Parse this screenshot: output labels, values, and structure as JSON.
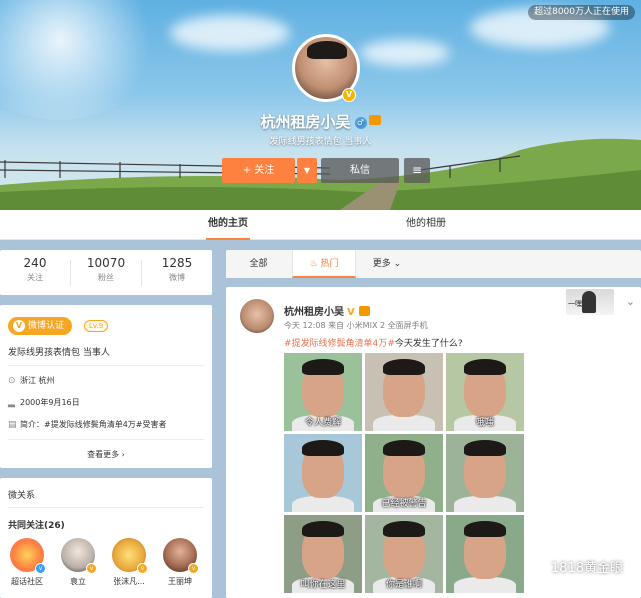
{
  "cover": {
    "online_badge": "超过8000万人正在使用"
  },
  "profile": {
    "name": "杭州租房小吴",
    "gender_icon": "♂",
    "description": "发际线男孩表情包 当事人",
    "follow_label": "+ 关注",
    "message_label": "私信",
    "menu_icon": "≡"
  },
  "tabs": {
    "home": "他的主页",
    "album": "他的相册"
  },
  "stats": [
    {
      "value": "240",
      "label": "关注"
    },
    {
      "value": "10070",
      "label": "粉丝"
    },
    {
      "value": "1285",
      "label": "微博"
    }
  ],
  "about": {
    "verify": "微博认证",
    "level": "Lv.9",
    "desc": "发际线男孩表情包 当事人",
    "location": "浙江 杭州",
    "birthday": "2000年9月16日",
    "intro": "简介：#提发际线修鬓角清单4万#受害者",
    "see_more": "查看更多 ›"
  },
  "relations": {
    "title": "微关系",
    "common_follow": "共同关注(26)",
    "friends": [
      {
        "name": "超话社区",
        "color": "#ff9a3c",
        "badge_color": "#3b9cff"
      },
      {
        "name": "袁立",
        "color": "#d9d2cb",
        "badge_color": "#f5a623"
      },
      {
        "name": "张沫凡...",
        "color": "#f2c14e",
        "badge_color": "#f5a623"
      },
      {
        "name": "王丽坤",
        "color": "#a46b52",
        "badge_color": "#f5a623"
      }
    ]
  },
  "feed": {
    "tabs": [
      "全部",
      "热门",
      "更多 ⌄"
    ],
    "hot_icon": "flame-icon"
  },
  "post": {
    "author": "杭州租房小吴",
    "meta": "今天 12:08 来自 小米MIX 2 全面屏手机",
    "topic": "#提发际线修鬓角清单4万#",
    "text": "今天发生了什么?",
    "corner_text": "一嘿",
    "images": [
      {
        "caption": "令人费解",
        "bg": "#9ac19a"
      },
      {
        "caption": "",
        "bg": "#c9c0b4"
      },
      {
        "caption": "哦嗤",
        "bg": "#b6c8a3"
      },
      {
        "caption": "",
        "bg": "#a8c7d8"
      },
      {
        "caption": "已经被警告",
        "bg": "#8fb08a"
      },
      {
        "caption": "",
        "bg": "#9cb39a"
      },
      {
        "caption": "叫你在这里",
        "bg": "#8d9d86"
      },
      {
        "caption": "你是谁啊",
        "bg": "#a4b6a0"
      },
      {
        "caption": "",
        "bg": "#8aa98a"
      }
    ]
  },
  "watermark": "1818黄金眼"
}
